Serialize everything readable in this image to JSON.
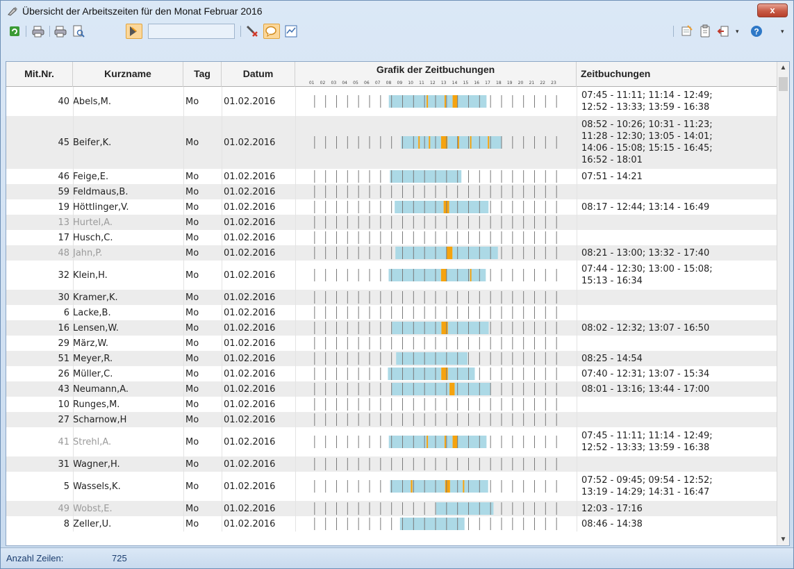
{
  "window": {
    "title": "Übersicht der Arbeitszeiten für den Monat Februar 2016",
    "close_label": "x"
  },
  "toolbar": {
    "search_value": "",
    "icons": [
      "refresh-icon",
      "print-icon",
      "print-setup-icon",
      "preview-icon",
      "highlight-icon",
      "filter-remove-icon",
      "comment-icon",
      "chart-icon",
      "export-icon",
      "clipboard-icon",
      "exit-icon",
      "help-icon"
    ]
  },
  "table": {
    "headers": {
      "nr": "Mit.Nr.",
      "name": "Kurzname",
      "tag": "Tag",
      "datum": "Datum",
      "grafik": "Grafik der Zeitbuchungen",
      "zeit": "Zeitbuchungen"
    },
    "hours": [
      "01",
      "02",
      "03",
      "04",
      "05",
      "06",
      "07",
      "08",
      "09",
      "10",
      "11",
      "12",
      "13",
      "14",
      "15",
      "16",
      "17",
      "18",
      "19",
      "20",
      "21",
      "22",
      "23"
    ],
    "colors": {
      "booked": "#acd9e6",
      "break": "#f5a30f",
      "tick": "#7a7a7a"
    },
    "rows": [
      {
        "nr": "40",
        "name": "Abels,M.",
        "tag": "Mo",
        "datum": "01.02.2016",
        "zeit": "07:45 - 11:11; 11:14 - 12:49;\n12:52 - 13:33; 13:59 - 16:38",
        "dim": false
      },
      {
        "nr": "45",
        "name": "Beifer,K.",
        "tag": "Mo",
        "datum": "01.02.2016",
        "zeit": "08:52 - 10:26; 10:31 - 11:23;\n11:28 - 12:30; 13:05 - 14:01;\n14:06 - 15:08; 15:15 - 16:45;\n16:52 - 18:01",
        "dim": false
      },
      {
        "nr": "46",
        "name": "Feige,E.",
        "tag": "Mo",
        "datum": "01.02.2016",
        "zeit": "07:51 - 14:21",
        "dim": false
      },
      {
        "nr": "59",
        "name": "Feldmaus,B.",
        "tag": "Mo",
        "datum": "01.02.2016",
        "zeit": "",
        "dim": false
      },
      {
        "nr": "19",
        "name": "Höttlinger,V.",
        "tag": "Mo",
        "datum": "01.02.2016",
        "zeit": "08:17 - 12:44; 13:14 - 16:49",
        "dim": false
      },
      {
        "nr": "13",
        "name": "Hurtel,A.",
        "tag": "Mo",
        "datum": "01.02.2016",
        "zeit": "",
        "dim": true
      },
      {
        "nr": "17",
        "name": "Husch,C.",
        "tag": "Mo",
        "datum": "01.02.2016",
        "zeit": "",
        "dim": false
      },
      {
        "nr": "48",
        "name": "Jahn,P.",
        "tag": "Mo",
        "datum": "01.02.2016",
        "zeit": "08:21 - 13:00; 13:32 - 17:40",
        "dim": true
      },
      {
        "nr": "32",
        "name": "Klein,H.",
        "tag": "Mo",
        "datum": "01.02.2016",
        "zeit": "07:44 - 12:30; 13:00 - 15:08;\n15:13 - 16:34",
        "dim": false
      },
      {
        "nr": "30",
        "name": "Kramer,K.",
        "tag": "Mo",
        "datum": "01.02.2016",
        "zeit": "",
        "dim": false
      },
      {
        "nr": "6",
        "name": "Lacke,B.",
        "tag": "Mo",
        "datum": "01.02.2016",
        "zeit": "",
        "dim": false
      },
      {
        "nr": "16",
        "name": "Lensen,W.",
        "tag": "Mo",
        "datum": "01.02.2016",
        "zeit": "08:02 - 12:32; 13:07 - 16:50",
        "dim": false
      },
      {
        "nr": "29",
        "name": "März,W.",
        "tag": "Mo",
        "datum": "01.02.2016",
        "zeit": "",
        "dim": false
      },
      {
        "nr": "51",
        "name": "Meyer,R.",
        "tag": "Mo",
        "datum": "01.02.2016",
        "zeit": "08:25 - 14:54",
        "dim": false
      },
      {
        "nr": "26",
        "name": "Müller,C.",
        "tag": "Mo",
        "datum": "01.02.2016",
        "zeit": "07:40 - 12:31; 13:07 - 15:34",
        "dim": false
      },
      {
        "nr": "43",
        "name": "Neumann,A.",
        "tag": "Mo",
        "datum": "01.02.2016",
        "zeit": "08:01 - 13:16; 13:44 - 17:00",
        "dim": false
      },
      {
        "nr": "10",
        "name": "Runges,M.",
        "tag": "Mo",
        "datum": "01.02.2016",
        "zeit": "",
        "dim": false
      },
      {
        "nr": "27",
        "name": "Scharnow,H",
        "tag": "Mo",
        "datum": "01.02.2016",
        "zeit": "",
        "dim": false
      },
      {
        "nr": "41",
        "name": "Strehl,A.",
        "tag": "Mo",
        "datum": "01.02.2016",
        "zeit": "07:45 - 11:11; 11:14 - 12:49;\n12:52 - 13:33; 13:59 - 16:38",
        "dim": true
      },
      {
        "nr": "31",
        "name": "Wagner,H.",
        "tag": "Mo",
        "datum": "01.02.2016",
        "zeit": "",
        "dim": false
      },
      {
        "nr": "5",
        "name": "Wassels,K.",
        "tag": "Mo",
        "datum": "01.02.2016",
        "zeit": "07:52 - 09:45; 09:54 - 12:52;\n13:19 - 14:29; 14:31 - 16:47",
        "dim": false
      },
      {
        "nr": "49",
        "name": "Wobst,E.",
        "tag": "Mo",
        "datum": "01.02.2016",
        "zeit": "12:03 - 17:16",
        "dim": true
      },
      {
        "nr": "8",
        "name": "Zeller,U.",
        "tag": "Mo",
        "datum": "01.02.2016",
        "zeit": "08:46 - 14:38",
        "dim": false
      }
    ]
  },
  "status": {
    "label": "Anzahl Zeilen:",
    "value": "725"
  }
}
